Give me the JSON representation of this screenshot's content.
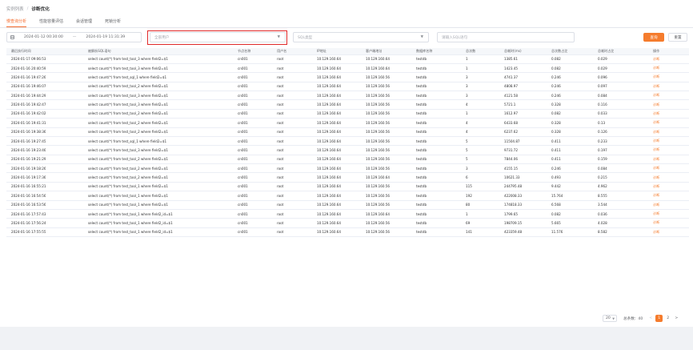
{
  "breadcrumb": {
    "parent": "实例列表",
    "separator": "/",
    "current": "诊断优化"
  },
  "tabs": [
    {
      "label": "慢查询分析",
      "active": true
    },
    {
      "label": "性能容量评估",
      "active": false
    },
    {
      "label": "会话管理",
      "active": false
    },
    {
      "label": "死锁分析",
      "active": false
    }
  ],
  "filters": {
    "date_start": "2024-01-12 00:30:00",
    "date_separator": "—",
    "date_end": "2024-01-19 11:31:39",
    "user_placeholder": "全部用户",
    "sql_type_placeholder": "SQL类型",
    "sql_input_placeholder": "请输入SQL语句",
    "query_label": "查询",
    "reset_label": "重置"
  },
  "table": {
    "columns": [
      "最后执行时间",
      "被解析SQL语句",
      "节点名称",
      "用户名",
      "IP地址",
      "客户端地址",
      "数据库名称",
      "总次数",
      "总耗时(ms)",
      "总次数占比",
      "总耗时占比",
      "操作"
    ],
    "rows": [
      [
        "2024-01-17 09:06:53",
        "select count(*) from test_tool_3 where field2=$1",
        "cn001",
        "root",
        "10.129.160.64",
        "10.129.160.64",
        "testdb",
        "1",
        "1385.61",
        "0.082",
        "0.029",
        "诊断"
      ],
      [
        "2024-01-16 20:40:59",
        "select count(*) from test_tool_3 where field2=$1",
        "cn001",
        "root",
        "10.129.160.64",
        "10.129.160.64",
        "testdb",
        "1",
        "1423.45",
        "0.082",
        "0.029",
        "诊断"
      ],
      [
        "2024-01-16 19:47:26",
        "select count(*) from test_sql_1 where field2=$1",
        "cn001",
        "root",
        "10.129.160.64",
        "10.129.160.56",
        "testdb",
        "3",
        "4741.37",
        "0.246",
        "0.096",
        "诊断"
      ],
      [
        "2024-01-16 19:46:07",
        "select count(*) from test_tool_2 where field2=$1",
        "cn001",
        "root",
        "10.129.160.64",
        "10.129.160.56",
        "testdb",
        "3",
        "4808.97",
        "0.246",
        "0.097",
        "诊断"
      ],
      [
        "2024-01-16 19:44:29",
        "select count(*) from test_tool_3 where field2=$1",
        "cn001",
        "root",
        "10.129.160.64",
        "10.129.160.56",
        "testdb",
        "3",
        "4121.58",
        "0.246",
        "0.084",
        "诊断"
      ],
      [
        "2024-01-16 19:42:47",
        "select count(*) from test_tool_3 where field2=$1",
        "cn001",
        "root",
        "10.129.160.64",
        "10.129.160.56",
        "testdb",
        "4",
        "5721.1",
        "0.328",
        "0.116",
        "诊断"
      ],
      [
        "2024-01-16 19:42:02",
        "select count(*) from test_tool_2 where field2=$1",
        "cn001",
        "root",
        "10.129.160.64",
        "10.129.160.56",
        "testdb",
        "1",
        "1612.97",
        "0.082",
        "0.033",
        "诊断"
      ],
      [
        "2024-01-16 19:41:31",
        "select count(*) from test_tool_2 where field2=$1",
        "cn001",
        "root",
        "10.129.160.64",
        "10.129.160.56",
        "testdb",
        "4",
        "6433.68",
        "0.328",
        "0.13",
        "诊断"
      ],
      [
        "2024-01-16 19:38:36",
        "select count(*) from test_tool_2 where field2=$1",
        "cn001",
        "root",
        "10.129.160.64",
        "10.129.160.56",
        "testdb",
        "4",
        "6237.62",
        "0.328",
        "0.126",
        "诊断"
      ],
      [
        "2024-01-16 19:27:45",
        "select count(*) from test_sql_1 where field2=$1",
        "cn001",
        "root",
        "10.129.160.64",
        "10.129.160.56",
        "testdb",
        "5",
        "11504.87",
        "0.411",
        "0.233",
        "诊断"
      ],
      [
        "2024-01-16 19:23:46",
        "select count(*) from test_tool_3 where field2=$1",
        "cn001",
        "root",
        "10.129.160.64",
        "10.129.160.56",
        "testdb",
        "5",
        "9731.72",
        "0.411",
        "0.197",
        "诊断"
      ],
      [
        "2024-01-16 19:21:29",
        "select count(*) from test_tool_2 where field2=$1",
        "cn001",
        "root",
        "10.129.160.64",
        "10.129.160.56",
        "testdb",
        "5",
        "7844.06",
        "0.411",
        "0.159",
        "诊断"
      ],
      [
        "2024-01-16 19:18:26",
        "select count(*) from test_tool_2 where field2=$1",
        "cn001",
        "root",
        "10.129.160.64",
        "10.129.160.56",
        "testdb",
        "3",
        "4155.15",
        "0.246",
        "0.084",
        "诊断"
      ],
      [
        "2024-01-16 19:17:36",
        "select count(*) from test_tool_2 where field2=$1",
        "cn001",
        "root",
        "10.129.160.64",
        "10.129.160.64",
        "testdb",
        "6",
        "10621.33",
        "0.493",
        "0.215",
        "诊断"
      ],
      [
        "2024-01-16 16:55:21",
        "select count(*) from test_tool_1 where field2=$1",
        "cn001",
        "root",
        "10.129.160.64",
        "10.129.160.56",
        "testdb",
        "115",
        "244795.48",
        "9.442",
        "4.962",
        "诊断"
      ],
      [
        "2024-01-16 16:54:56",
        "select count(*) from test_tool_1 where field2=$1",
        "cn001",
        "root",
        "10.129.160.64",
        "10.129.160.56",
        "testdb",
        "192",
        "422008.33",
        "15.764",
        "8.555",
        "诊断"
      ],
      [
        "2024-01-16 16:53:56",
        "select count(*) from test_tool_1 where field2=$1",
        "cn001",
        "root",
        "10.129.160.64",
        "10.129.160.56",
        "testdb",
        "80",
        "174818.33",
        "6.568",
        "3.544",
        "诊断"
      ],
      [
        "2024-01-16 17:57:43",
        "select count(*) from test_tool_1 where field2_id=$1",
        "cn001",
        "root",
        "10.129.160.64",
        "10.129.160.64",
        "testdb",
        "1",
        "1799.65",
        "0.082",
        "0.036",
        "诊断"
      ],
      [
        "2024-01-16 17:56:24",
        "select count(*) from test_tool_1 where field2_id=$1",
        "cn001",
        "root",
        "10.129.160.64",
        "10.129.160.56",
        "testdb",
        "69",
        "198709.15",
        "5.665",
        "4.028",
        "诊断"
      ],
      [
        "2024-01-16 17:55:55",
        "select count(*) from test_tool_1 where field2_id=$1",
        "cn001",
        "root",
        "10.129.160.64",
        "10.129.160.56",
        "testdb",
        "141",
        "423359.48",
        "11.576",
        "8.582",
        "诊断"
      ]
    ]
  },
  "pagination": {
    "page_size": "20",
    "total_label": "总条数：",
    "total": "40",
    "prev": "<",
    "pages": [
      "1",
      "2"
    ],
    "current_page": "1",
    "next": ">"
  },
  "colors": {
    "accent": "#f57c2d",
    "highlight_border": "#e12a2a"
  }
}
